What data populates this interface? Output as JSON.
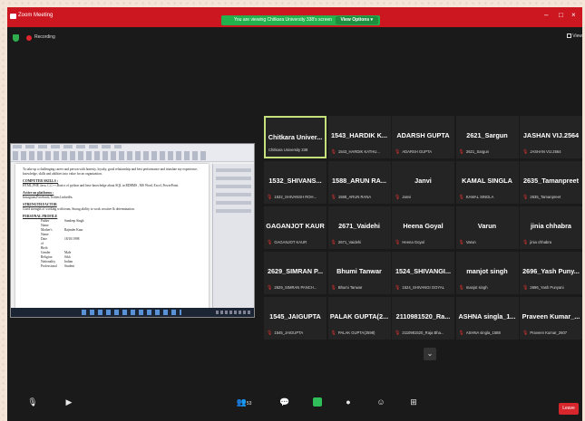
{
  "window": {
    "title": "Zoom Meeting",
    "share_banner": "You are viewing Chitkara University 338's screen",
    "view_options": "View Options ▾",
    "controls": {
      "minimize": "–",
      "maximize": "□",
      "close": "×"
    }
  },
  "status": {
    "recording_label": "Recording",
    "view_label": "View"
  },
  "shared_screen": {
    "objective": "To take up a challenging career and person with honesty, loyalty, good relationship and best performance and translate my experience, knowledge, skills and abilities into value for an organization.",
    "computer_skills_heading": "COMPUTER SKILLS :",
    "computer_skills_text": "HTML,PHP, Java, C,C++,Basics of python and have knowledge about SQL in RDBMS , MS Word, Excel, PowerPoint.",
    "active_platforms_heading": "Active on platforms :",
    "active_platforms_text": "Instagram,Facebook,Twitter,LinkedIn.",
    "strength_heading": "STRENGTH FACTOR",
    "strength_text": "Good strength of working with team, Strong ability to work creative & determination.",
    "personal_heading": "PERSONAL PROFILE",
    "profile": [
      {
        "k": "Father Name",
        "v": "Sandeep Singh"
      },
      {
        "k": "Mother's Name",
        "v": "Rajinder Kaur"
      },
      {
        "k": "Date of Birth",
        "v": "18/10/1998"
      },
      {
        "k": "Gender",
        "v": "Male"
      },
      {
        "k": "Religion",
        "v": "Sikh"
      },
      {
        "k": "Nationality",
        "v": "Indian"
      },
      {
        "k": "Professional",
        "v": "Student"
      }
    ]
  },
  "participants": [
    {
      "name": "Chitkara Univer...",
      "sub": "Chitkara University 338",
      "active": true,
      "muted": false
    },
    {
      "name": "1543_HARDIK K...",
      "sub": "1543_HARDIK KATHU...",
      "active": false,
      "muted": true
    },
    {
      "name": "ADARSH GUPTA",
      "sub": "ADARSH GUPTA",
      "active": false,
      "muted": true
    },
    {
      "name": "2621_Sargun",
      "sub": "2621_Sargun",
      "active": false,
      "muted": true
    },
    {
      "name": "JASHAN VIJ.2564",
      "sub": "JASHAN VIJ.2564",
      "active": false,
      "muted": true
    },
    {
      "name": "1532_SHIVANS...",
      "sub": "1532_SHIVANSH ROH...",
      "active": false,
      "muted": true
    },
    {
      "name": "1588_ARUN RA...",
      "sub": "1588_ARUN RANA",
      "active": false,
      "muted": true
    },
    {
      "name": "Janvi",
      "sub": "Janvi",
      "active": false,
      "muted": true
    },
    {
      "name": "KAMAL SINGLA",
      "sub": "KAMAL SINGLA",
      "active": false,
      "muted": true
    },
    {
      "name": "2635_Tamanpreet",
      "sub": "2635_Tamanpreet",
      "active": false,
      "muted": true
    },
    {
      "name": "GAGANJOT KAUR",
      "sub": "GAGANJOT KAUR",
      "active": false,
      "muted": true
    },
    {
      "name": "2671_Vaidehi",
      "sub": "2671_Vaidehi",
      "active": false,
      "muted": true
    },
    {
      "name": "Heena Goyal",
      "sub": "Heena Goyal",
      "active": false,
      "muted": true
    },
    {
      "name": "Varun",
      "sub": "Varun",
      "active": false,
      "muted": true
    },
    {
      "name": "jinia chhabra",
      "sub": "jinia chhabra",
      "active": false,
      "muted": true
    },
    {
      "name": "2629_SIMRAN P...",
      "sub": "2629_SIMRAN PANCH...",
      "active": false,
      "muted": true
    },
    {
      "name": "Bhumi Tanwar",
      "sub": "Bhumi Tanwar",
      "active": false,
      "muted": true
    },
    {
      "name": "1524_SHIVANGI...",
      "sub": "1524_SHIVANGI GOYAL",
      "active": false,
      "muted": true
    },
    {
      "name": "manjot singh",
      "sub": "manjot singh",
      "active": false,
      "muted": true
    },
    {
      "name": "2696_Yash Puny...",
      "sub": "2696_Yash Punyani",
      "active": false,
      "muted": true
    },
    {
      "name": "1545_JAIGUPTA",
      "sub": "1545_JAIGUPTA",
      "active": false,
      "muted": true
    },
    {
      "name": "PALAK GUPTA(2...",
      "sub": "PALAK GUPTA(2598)",
      "active": false,
      "muted": true
    },
    {
      "name": "2110981520_Ra...",
      "sub": "2110981520_Raja Bha...",
      "active": false,
      "muted": true
    },
    {
      "name": "ASHNA singla_1...",
      "sub": "ASHNA singla_1588",
      "active": false,
      "muted": true
    },
    {
      "name": "Praveen Kumar_...",
      "sub": "Praveen Kumar_2607",
      "active": false,
      "muted": true
    }
  ],
  "toolbar": {
    "participants_count": "53",
    "leave": "Leave"
  },
  "colors": {
    "zoom_red": "#cc1620",
    "share_green": "#23b14d",
    "active_speaker": "#c6e07b",
    "leave_red": "#d8262d"
  },
  "icons": [
    "mic-muted-icon",
    "video-off-icon",
    "participants-icon",
    "chat-icon",
    "share-screen-icon",
    "record-icon",
    "reactions-icon",
    "apps-icon",
    "down-arrow-icon"
  ]
}
